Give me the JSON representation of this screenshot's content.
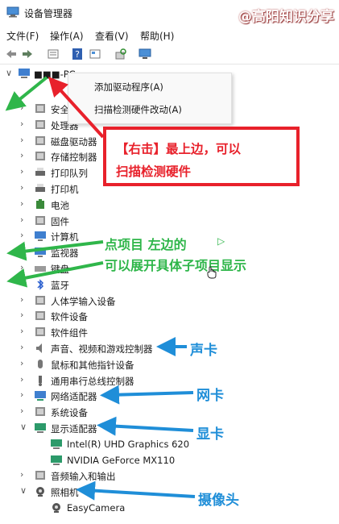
{
  "window": {
    "title": "设备管理器",
    "watermark": "@高阳知识分享"
  },
  "menu": [
    "文件(F)",
    "操作(A)",
    "查看(V)",
    "帮助(H)"
  ],
  "toolbar": [
    "back-icon",
    "forward-icon",
    "properties-icon",
    "help-icon",
    "view-icon",
    "scan-icon",
    "monitor-icon"
  ],
  "tree": {
    "root": "■■■-PC",
    "items": [
      {
        "label": "安全",
        "icon": "shield-icon",
        "expanded": false
      },
      {
        "label": "处理器",
        "icon": "cpu-icon",
        "expanded": false
      },
      {
        "label": "磁盘驱动器",
        "icon": "disk-icon",
        "expanded": false
      },
      {
        "label": "存储控制器",
        "icon": "storage-icon",
        "expanded": false
      },
      {
        "label": "打印队列",
        "icon": "print-queue-icon",
        "expanded": false
      },
      {
        "label": "打印机",
        "icon": "printer-icon",
        "expanded": false
      },
      {
        "label": "电池",
        "icon": "battery-icon",
        "expanded": false
      },
      {
        "label": "固件",
        "icon": "firmware-icon",
        "expanded": false
      },
      {
        "label": "计算机",
        "icon": "computer-icon",
        "expanded": false
      },
      {
        "label": "监视器",
        "icon": "monitor-icon",
        "expanded": false
      },
      {
        "label": "键盘",
        "icon": "keyboard-icon",
        "expanded": false
      },
      {
        "label": "蓝牙",
        "icon": "bluetooth-icon",
        "expanded": false
      },
      {
        "label": "人体学输入设备",
        "icon": "hid-icon",
        "expanded": false
      },
      {
        "label": "软件设备",
        "icon": "software-device-icon",
        "expanded": false
      },
      {
        "label": "软件组件",
        "icon": "software-component-icon",
        "expanded": false
      },
      {
        "label": "声音、视频和游戏控制器",
        "icon": "speaker-icon",
        "expanded": false
      },
      {
        "label": "鼠标和其他指针设备",
        "icon": "mouse-icon",
        "expanded": false
      },
      {
        "label": "通用串行总线控制器",
        "icon": "usb-icon",
        "expanded": false
      },
      {
        "label": "网络适配器",
        "icon": "network-icon",
        "expanded": false
      },
      {
        "label": "系统设备",
        "icon": "system-device-icon",
        "expanded": false
      },
      {
        "label": "显示适配器",
        "icon": "display-adapter-icon",
        "expanded": true
      },
      {
        "label": "Intel(R) UHD Graphics 620",
        "icon": "display-adapter-icon",
        "child": true
      },
      {
        "label": "NVIDIA GeForce MX110",
        "icon": "display-adapter-icon",
        "child": true
      },
      {
        "label": "音频输入和输出",
        "icon": "audio-io-icon",
        "expanded": false
      },
      {
        "label": "照相机",
        "icon": "camera-icon",
        "expanded": true
      },
      {
        "label": "EasyCamera",
        "icon": "camera-icon",
        "child": true
      }
    ]
  },
  "context_menu": {
    "add_driver": "添加驱动程序(A)",
    "scan": "扫描检测硬件改动(A)"
  },
  "annotations": {
    "callout_line1": "【右击】最上边，可以",
    "callout_line2": "扫描检测硬件",
    "expand_line1": "点项目 左边的",
    "expand_line2": "可以展开具体子项目显示",
    "sound": "声卡",
    "network": "网卡",
    "display": "显卡",
    "camera": "摄像头"
  },
  "colors": {
    "red": "#e8212b",
    "green": "#2fb64a",
    "blue": "#1f8ed8"
  }
}
